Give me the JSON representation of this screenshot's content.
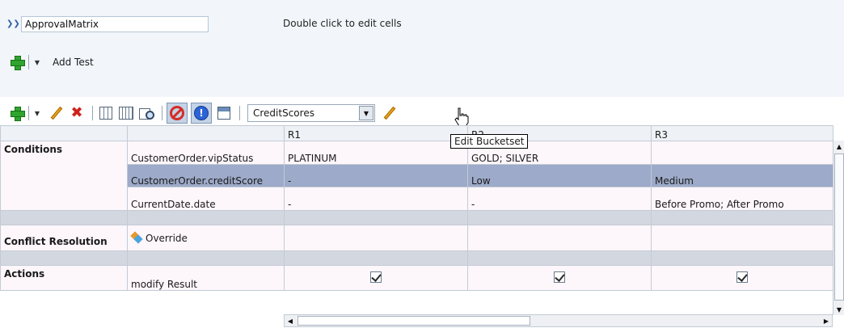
{
  "header": {
    "name_value": "ApprovalMatrix",
    "hint": "Double click to edit cells",
    "add_test_label": "Add Test"
  },
  "toolbar": {
    "bucketset_select": "CreditScores",
    "tooltip": "Edit Bucketset"
  },
  "table": {
    "columns": [
      "R1",
      "R2",
      "R3"
    ],
    "sections": {
      "conditions": "Conditions",
      "conflict": "Conflict Resolution",
      "actions": "Actions"
    },
    "rows": {
      "vip": {
        "label": "CustomerOrder.vipStatus",
        "r1": "PLATINUM",
        "r2": "GOLD; SILVER",
        "r3": ""
      },
      "credit": {
        "label": "CustomerOrder.creditScore",
        "r1": "-",
        "r2": "Low",
        "r3": "Medium"
      },
      "date": {
        "label": "CurrentDate.date",
        "r1": "-",
        "r2": "-",
        "r3": "Before Promo; After Promo"
      },
      "override": {
        "label": "Override"
      },
      "modify": {
        "label": "modify Result",
        "r1_checked": true,
        "r2_checked": true,
        "r3_checked": true
      }
    }
  },
  "colors": {
    "selected_row": "#9daac9",
    "toolbar_bg": "#f2f6fb"
  }
}
